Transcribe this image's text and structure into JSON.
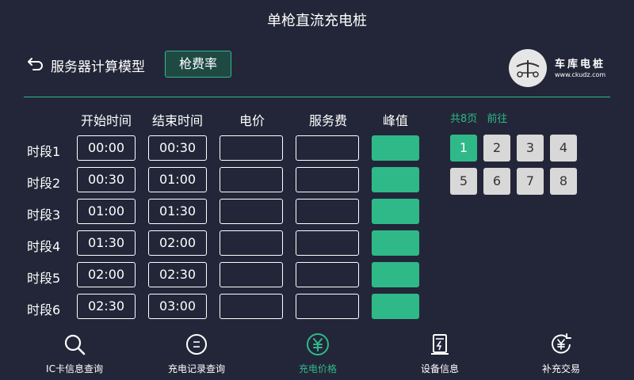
{
  "app_title": "单枪直流充电桩",
  "page_title": "服务器计算模型",
  "mode_button": "枪费率",
  "logo": {
    "name": "车库电桩",
    "url": "www.ckudz.com"
  },
  "columns": [
    "开始时间",
    "结束时间",
    "电价",
    "服务费",
    "峰值"
  ],
  "rows": [
    {
      "label": "时段1",
      "start": "00:00",
      "end": "00:30",
      "price": "",
      "service": ""
    },
    {
      "label": "时段2",
      "start": "00:30",
      "end": "01:00",
      "price": "",
      "service": ""
    },
    {
      "label": "时段3",
      "start": "01:00",
      "end": "01:30",
      "price": "",
      "service": ""
    },
    {
      "label": "时段4",
      "start": "01:30",
      "end": "02:00",
      "price": "",
      "service": ""
    },
    {
      "label": "时段5",
      "start": "02:00",
      "end": "02:30",
      "price": "",
      "service": ""
    },
    {
      "label": "时段6",
      "start": "02:30",
      "end": "03:00",
      "price": "",
      "service": ""
    }
  ],
  "pager": {
    "total_text": "共8页",
    "goto_text": "前往",
    "pages": [
      "1",
      "2",
      "3",
      "4",
      "5",
      "6",
      "7",
      "8"
    ],
    "current_page": 1
  },
  "bottom_nav": [
    {
      "label": "IC卡信息查询",
      "icon": "search-icon"
    },
    {
      "label": "充电记录查询",
      "icon": "record-icon"
    },
    {
      "label": "充电价格",
      "icon": "yuan-circle-icon",
      "active": true
    },
    {
      "label": "设备信息",
      "icon": "charger-icon"
    },
    {
      "label": "补充交易",
      "icon": "yuan-refresh-icon"
    }
  ],
  "colors": {
    "background": "#232638",
    "accent": "#2fb989",
    "text": "#ffffff"
  }
}
